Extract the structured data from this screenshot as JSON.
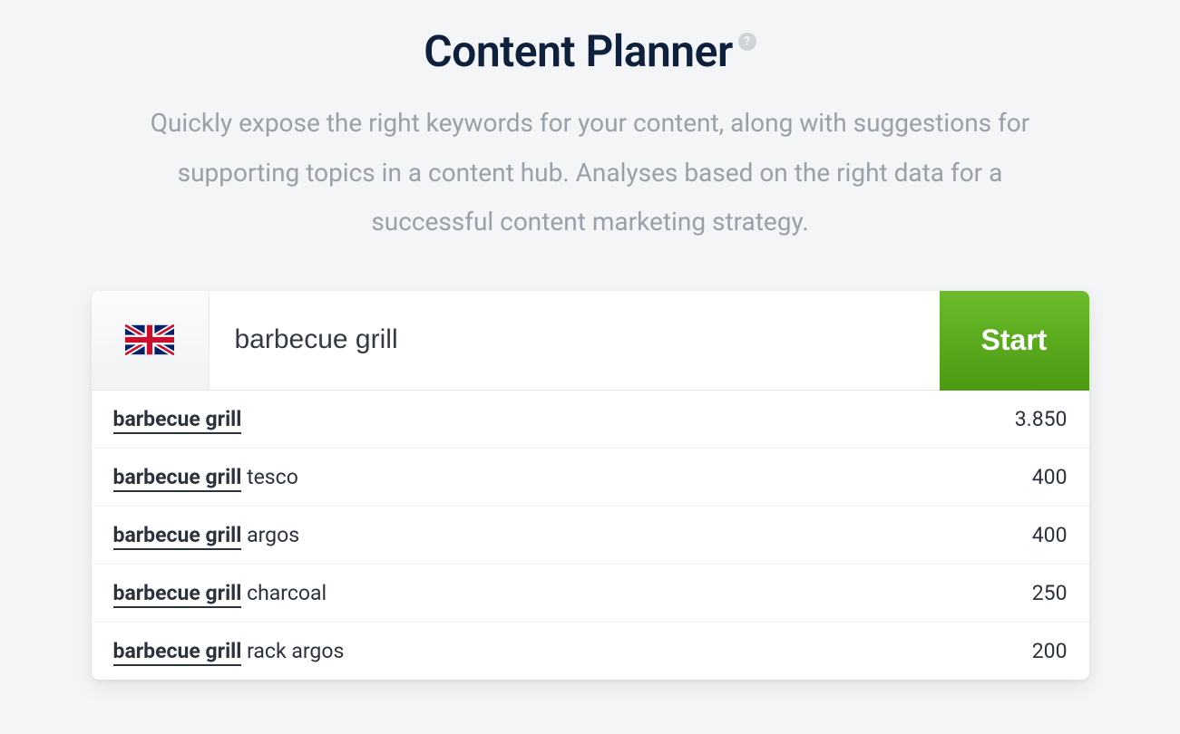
{
  "header": {
    "title": "Content Planner",
    "help_symbol": "?",
    "subtitle": "Quickly expose the right keywords for your content, along with suggestions for supporting topics in a content hub. Analyses based on the right data for a successful content marketing strategy."
  },
  "search": {
    "country": "uk",
    "country_name": "United Kingdom",
    "input_value": "barbecue grill",
    "start_label": "Start"
  },
  "suggestions": [
    {
      "match": "barbecue grill",
      "rest": "",
      "value": "3.850"
    },
    {
      "match": "barbecue grill",
      "rest": " tesco",
      "value": "400"
    },
    {
      "match": "barbecue grill",
      "rest": " argos",
      "value": "400"
    },
    {
      "match": "barbecue grill",
      "rest": " charcoal",
      "value": "250"
    },
    {
      "match": "barbecue grill",
      "rest": " rack argos",
      "value": "200"
    }
  ]
}
